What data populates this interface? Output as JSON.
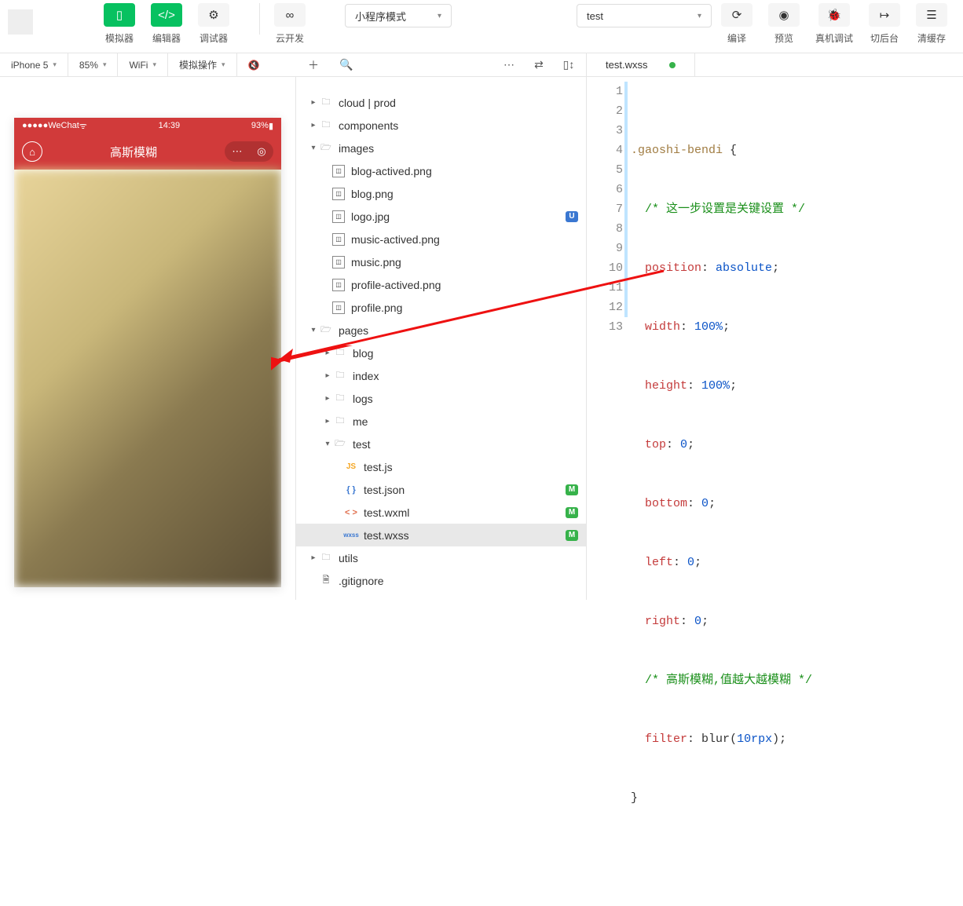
{
  "toolbar": {
    "simulator": "模拟器",
    "editor": "编辑器",
    "debugger": "调试器",
    "cloud": "云开发",
    "mode": "小程序模式",
    "project": "test",
    "compile": "编译",
    "preview": "预览",
    "remote": "真机调试",
    "background": "切后台",
    "cache": "清缓存"
  },
  "subbar": {
    "device": "iPhone 5",
    "zoom": "85%",
    "network": "WiFi",
    "simop": "模拟操作"
  },
  "tab": {
    "name": "test.wxss"
  },
  "phone": {
    "carrier": "WeChat",
    "time": "14:39",
    "battery": "93%",
    "title": "高斯模糊"
  },
  "tree": {
    "cloud": "cloud | prod",
    "components": "components",
    "images": "images",
    "img1": "blog-actived.png",
    "img2": "blog.png",
    "img3": "logo.jpg",
    "img4": "music-actived.png",
    "img5": "music.png",
    "img6": "profile-actived.png",
    "img7": "profile.png",
    "pages": "pages",
    "blog": "blog",
    "index": "index",
    "logs": "logs",
    "me": "me",
    "test": "test",
    "testjs": "test.js",
    "testjson": "test.json",
    "testwxml": "test.wxml",
    "testwxss": "test.wxss",
    "utils": "utils",
    "gitignore": ".gitignore",
    "badgeU": "U",
    "badgeM": "M"
  },
  "code": {
    "l1": {
      "sel": ".gaoshi-bendi",
      "brace": " {"
    },
    "l2": "/* 这一步设置是关键设置 */",
    "l3p": "position",
    "l3v": "absolute",
    "l4p": "width",
    "l4v": "100%",
    "l5p": "height",
    "l5v": "100%",
    "l6p": "top",
    "l6v": "0",
    "l7p": "bottom",
    "l7v": "0",
    "l8p": "left",
    "l8v": "0",
    "l9p": "right",
    "l9v": "0",
    "l10": "/* 高斯模糊,值越大越模糊 */",
    "l11p": "filter",
    "l11f": "blur",
    "l11a": "10rpx",
    "l12": "}"
  }
}
